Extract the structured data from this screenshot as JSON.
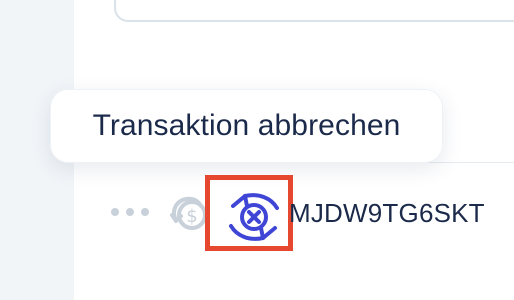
{
  "tooltip": {
    "text": "Transaktion abbrechen"
  },
  "row": {
    "transaction_id": "MJDW9TG6SKT",
    "actions": [
      {
        "icon": "ellipsis-icon",
        "interactable": true
      },
      {
        "icon": "refund-dollar-icon",
        "interactable": false
      },
      {
        "icon": "cancel-transaction-icon",
        "interactable": true
      }
    ]
  },
  "colors": {
    "highlight_border": "#e5482f",
    "cancel_icon": "#3f46d6",
    "muted_icon": "#c8d0d9",
    "text": "#1b2a4a",
    "left_rail": "#f1f5f8"
  }
}
